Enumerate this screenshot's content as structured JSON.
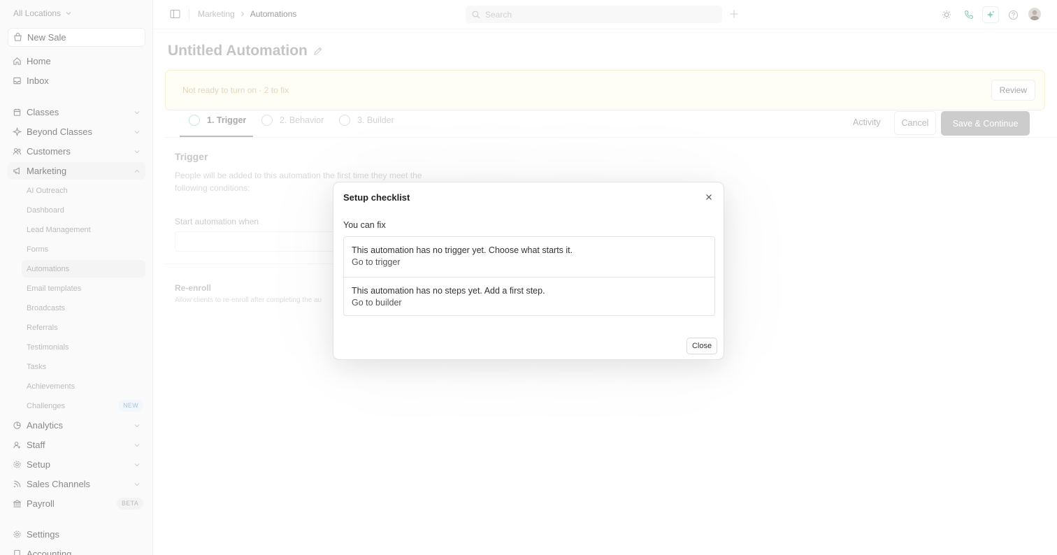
{
  "sidebar": {
    "location": "All Locations",
    "new_sale": "New Sale",
    "items": {
      "home": "Home",
      "inbox": "Inbox",
      "classes": "Classes",
      "beyond_classes": "Beyond Classes",
      "customers": "Customers",
      "marketing": "Marketing",
      "analytics": "Analytics",
      "staff": "Staff",
      "setup": "Setup",
      "sales_channels": "Sales Channels",
      "payroll": "Payroll",
      "settings": "Settings",
      "accounting": "Accounting"
    },
    "marketing_sub": {
      "ai_outreach": "AI Outreach",
      "dashboard": "Dashboard",
      "lead_management": "Lead Management",
      "forms": "Forms",
      "automations": "Automations",
      "email_templates": "Email templates",
      "broadcasts": "Broadcasts",
      "referrals": "Referrals",
      "testimonials": "Testimonials",
      "tasks": "Tasks",
      "achievements": "Achievements",
      "challenges": "Challenges"
    },
    "badges": {
      "challenges": "NEW",
      "payroll": "BETA"
    }
  },
  "topbar": {
    "breadcrumb": {
      "parent": "Marketing",
      "current": "Automations"
    },
    "search_placeholder": "Search"
  },
  "page": {
    "title": "Untitled Automation",
    "warning": {
      "text": "Not ready to turn on · 2 to fix",
      "review_label": "Review"
    },
    "tabs": {
      "trigger": "1. Trigger",
      "behavior": "2. Behavior",
      "builder": "3. Builder"
    },
    "actions": {
      "activity": "Activity",
      "cancel": "Cancel",
      "save": "Save & Continue"
    },
    "trigger_section": {
      "title": "Trigger",
      "description": "People will be added to this automation the first time they meet the following conditions:",
      "start_label": "Start automation when"
    },
    "reenroll": {
      "title": "Re-enroll",
      "description": "Allow clients to re-enroll after completing the au"
    }
  },
  "modal": {
    "title": "Setup checklist",
    "subtitle": "You can fix",
    "items": {
      "trigger": {
        "text": "This automation has no trigger yet. Choose what starts it.",
        "link": "Go to trigger"
      },
      "builder": {
        "text": "This automation has no steps yet. Add a first step.",
        "link": "Go to builder"
      }
    },
    "close_label": "Close"
  },
  "colors": {
    "accent_teal": "#3aa68a",
    "warning_bg": "#fdfbef",
    "warning_text": "#d2b88a",
    "save_disabled": "#a8a8a8",
    "new_badge": "#6b97c4"
  },
  "icons": {
    "sidebar": [
      "chevron-down-icon",
      "bag-icon",
      "home-icon",
      "inbox-icon",
      "calendar-icon",
      "sparkle-icon",
      "users-icon",
      "megaphone-icon",
      "chart-icon",
      "staff-icon",
      "gear-icon",
      "rss-icon",
      "bank-icon",
      "settings-icon"
    ],
    "topbar": [
      "sidebar-toggle-icon",
      "search-icon",
      "plus-icon",
      "sun-icon",
      "phone-icon",
      "ai-sparkle-icon",
      "help-icon",
      "avatar"
    ],
    "page": [
      "edit-pencil-icon",
      "close-icon"
    ]
  }
}
